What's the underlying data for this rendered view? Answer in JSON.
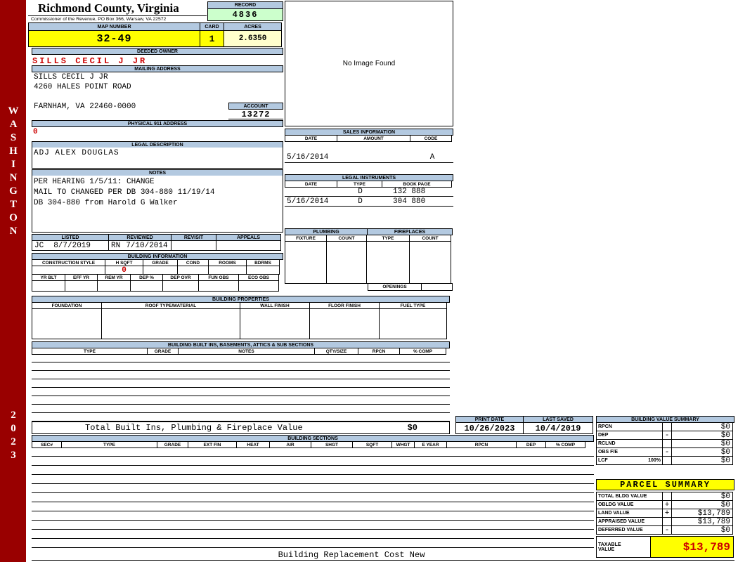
{
  "sidebar": {
    "name": "WASHINGTON",
    "year": "2023"
  },
  "header": {
    "title": "Richmond County, Virginia",
    "subtitle": "Commissioner of the Revenue, PO Box 366, Warsaw, VA 22572",
    "record_label": "RECORD",
    "record_value": "4836",
    "map_number_label": "MAP NUMBER",
    "map_number_value": "32-49",
    "card_label": "CARD",
    "card_value": "1",
    "acres_label": "ACRES",
    "acres_value": "2.6350"
  },
  "owner": {
    "deeded_owner_label": "DEEDED OWNER",
    "deeded_owner_name": "SILLS CECIL J JR",
    "mailing_address_label": "MAILING ADDRESS",
    "mailing_line1": "SILLS CECIL J JR",
    "mailing_line2": "4260 HALES POINT ROAD",
    "mailing_line3": "FARNHAM, VA 22460-0000",
    "account_label": "ACCOUNT",
    "account_value": "13272",
    "physical_address_label": "PHYSICAL 911 ADDRESS",
    "physical_address_value": "0"
  },
  "legal_description": {
    "label": "LEGAL DESCRIPTION",
    "value": "ADJ ALEX DOUGLAS"
  },
  "notes": {
    "label": "NOTES",
    "line1": "PER HEARING 1/5/11: CHANGE",
    "line2": "MAIL TO CHANGED PER DB 304-880 11/19/14",
    "line3": "DB 304-880 from Harold G Walker"
  },
  "review": {
    "listed_label": "LISTED",
    "reviewed_label": "REVIEWED",
    "revisit_label": "REVISIT",
    "appeals_label": "APPEALS",
    "listed_initials": "JC",
    "listed_date": "8/7/2019",
    "reviewed_initials": "RN",
    "reviewed_date": "7/10/2014"
  },
  "building_information": {
    "title": "BUILDING INFORMATION",
    "row1_headers": [
      "CONSTRUCTION STYLE",
      "H SQFT",
      "GRADE",
      "COND",
      "ROOMS",
      "BDRMS"
    ],
    "h_sqft_value": "0",
    "row2_headers": [
      "YR BLT",
      "EFF YR",
      "REM YR",
      "DEP %",
      "DEP OVR",
      "FUN OBS",
      "ECO OBS"
    ]
  },
  "building_properties": {
    "title": "BUILDING PROPERTIES",
    "headers": [
      "FOUNDATION",
      "ROOF TYPE/MATERIAL",
      "WALL FINISH",
      "FLOOR FINISH",
      "FUEL TYPE"
    ]
  },
  "built_ins": {
    "title": "BUILDING BUILT INS, BASEMENTS, ATTICS & SUB SECTIONS",
    "headers": [
      "TYPE",
      "GRADE",
      "NOTES",
      "QTY/SIZE",
      "RPCN",
      "% COMP"
    ],
    "total_label": "Total Built Ins, Plumbing & Fireplace Value",
    "total_value": "$0"
  },
  "image_panel": {
    "no_image_text": "No Image Found"
  },
  "sales_information": {
    "title": "SALES INFORMATION",
    "headers": [
      "DATE",
      "AMOUNT",
      "CODE"
    ],
    "rows": [
      {
        "date": "5/16/2014",
        "amount": "",
        "code": "A"
      }
    ]
  },
  "legal_instruments": {
    "title": "LEGAL INSTRUMENTS",
    "headers": [
      "DATE",
      "TYPE",
      "BOOK PAGE"
    ],
    "rows": [
      {
        "date": "",
        "type": "D",
        "book_page": "132 888"
      },
      {
        "date": "5/16/2014",
        "type": "D",
        "book_page": "304 880"
      }
    ]
  },
  "plumbing": {
    "title": "PLUMBING",
    "headers": [
      "FIXTURE",
      "COUNT"
    ]
  },
  "fireplaces": {
    "title": "FIREPLACES",
    "headers": [
      "TYPE",
      "COUNT"
    ],
    "openings_label": "OPENINGS"
  },
  "print_info": {
    "print_date_label": "PRINT DATE",
    "print_date_value": "10/26/2023",
    "last_saved_label": "LAST SAVED",
    "last_saved_value": "10/4/2019"
  },
  "building_value_summary": {
    "title": "BUILDING VALUE SUMMARY",
    "rows": [
      {
        "label": "RPCN",
        "label2": "",
        "op": "",
        "value": "$0"
      },
      {
        "label": "DEP",
        "label2": "",
        "op": "-",
        "value": "$0"
      },
      {
        "label": "RCLND",
        "label2": "",
        "op": "",
        "value": "$0"
      },
      {
        "label": "OBS F/E",
        "label2": "",
        "op": "-",
        "value": "$0"
      },
      {
        "label": "LCF",
        "label2": "100%",
        "op": "",
        "value": "$0"
      }
    ]
  },
  "building_sections": {
    "title": "BUILDING SECTIONS",
    "headers": [
      "SEC#",
      "TYPE",
      "GRADE",
      "EXT FIN",
      "HEAT",
      "AIR",
      "SHGT",
      "SQFT",
      "WHGT",
      "E YEAR",
      "RPCN",
      "DEP",
      "% COMP"
    ]
  },
  "parcel_summary": {
    "title": "PARCEL SUMMARY",
    "rows": [
      {
        "label": "TOTAL BLDG VALUE",
        "op": "",
        "value": "$0"
      },
      {
        "label": "OBLDG VALUE",
        "op": "+",
        "value": "$0"
      },
      {
        "label": "LAND VALUE",
        "op": "+",
        "value": "$13,789"
      },
      {
        "label": "APPRAISED VALUE",
        "op": "",
        "value": "$13,789"
      },
      {
        "label": "DEFERRED VALUE",
        "op": "-",
        "value": "$0"
      }
    ],
    "taxable_label_line1": "TAXABLE",
    "taxable_label_line2": "VALUE",
    "taxable_value": "$13,789"
  },
  "footer": {
    "text": "Building Replacement Cost New"
  }
}
